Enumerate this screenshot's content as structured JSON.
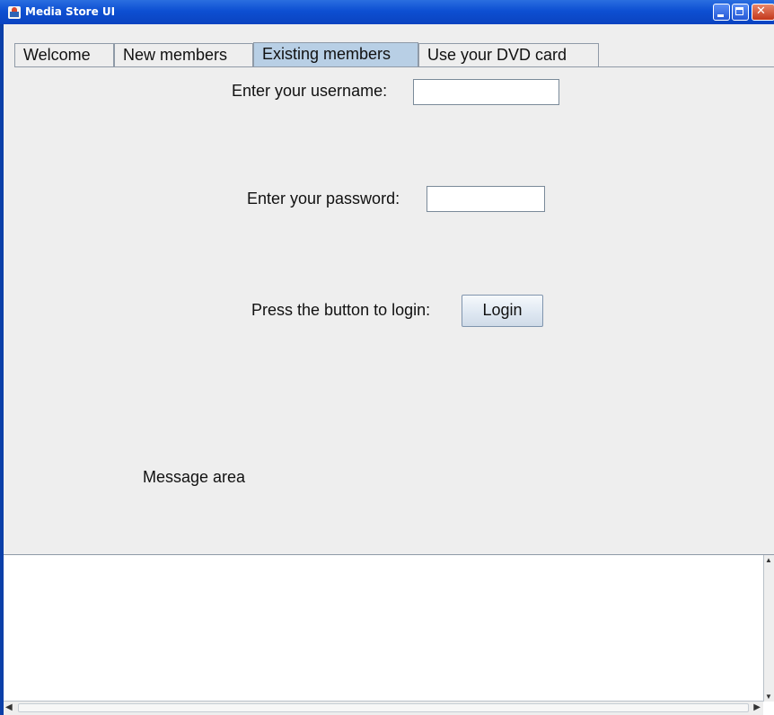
{
  "window": {
    "title": "Media Store UI"
  },
  "tabs": [
    {
      "label": "Welcome",
      "selected": false
    },
    {
      "label": "New members",
      "selected": false
    },
    {
      "label": "Existing members",
      "selected": true
    },
    {
      "label": "Use your DVD card",
      "selected": false
    }
  ],
  "form": {
    "username_label": "Enter your username:",
    "username_value": "",
    "password_label": "Enter your password:",
    "password_value": "",
    "login_prompt": "Press the button to login:",
    "login_button": "Login"
  },
  "message": {
    "label": "Message area",
    "text": ""
  },
  "icons": {
    "app": "java-cup-icon",
    "minimize": "minimize-icon",
    "maximize": "maximize-icon",
    "close": "close-icon"
  },
  "colors": {
    "titlebar": "#0d4fd2",
    "selected_tab": "#b8cfe5",
    "panel": "#eeeeee"
  }
}
